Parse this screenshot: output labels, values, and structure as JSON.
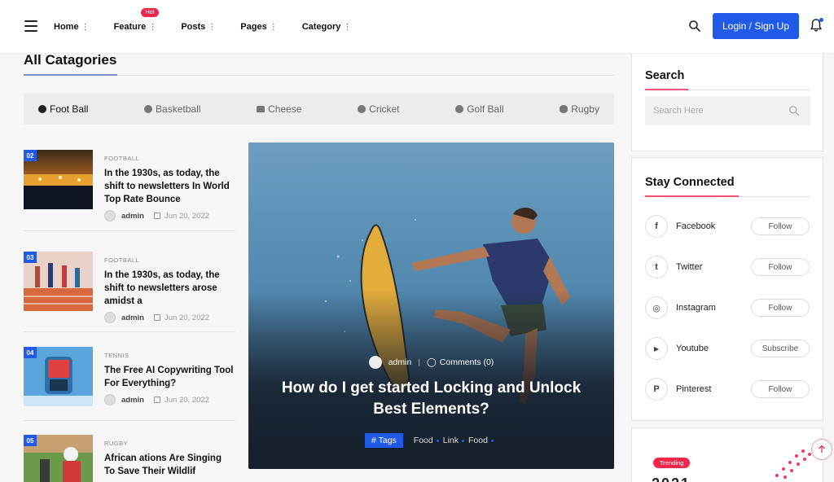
{
  "header": {
    "nav": [
      {
        "label": "Home",
        "dots": "⋮"
      },
      {
        "label": "Feature",
        "dots": "⋮",
        "badge": "Hot"
      },
      {
        "label": "Posts",
        "dots": "⋮"
      },
      {
        "label": "Pages",
        "dots": "⋮"
      },
      {
        "label": "Category",
        "dots": "⋮"
      }
    ],
    "login_label": "Login / Sign Up"
  },
  "categories": {
    "title": "All Catagories",
    "items": [
      "Foot Ball",
      "Basketball",
      "Cheese",
      "Cricket",
      "Golf Ball",
      "Rugby"
    ]
  },
  "posts": [
    {
      "num": "02",
      "category": "FOOTBALL",
      "title": "In the 1930s, as today, the shift to newsletters In World Top Rate Bounce",
      "author": "admin",
      "date": "Jun 20, 2022"
    },
    {
      "num": "03",
      "category": "FOOTBALL",
      "title": "In the 1930s, as today, the shift to newsletters arose amidst a",
      "author": "admin",
      "date": "Jun 20, 2022"
    },
    {
      "num": "04",
      "category": "TENNIS",
      "title": "The Free AI Copywriting Tool For Everything?",
      "author": "admin",
      "date": "Jun 20, 2022"
    },
    {
      "num": "05",
      "category": "RUGBY",
      "title": "African ations Are Singing To Save Their Wildlif"
    }
  ],
  "featured": {
    "author": "admin",
    "comments": "Comments (0)",
    "title": "How do I get started Locking and Unlock Best Elements?",
    "tag_button": "# Tags",
    "tags": [
      "Food",
      "Link",
      "Food"
    ]
  },
  "sidebar": {
    "search_title": "Search",
    "search_placeholder": "Search Here",
    "connect_title": "Stay Connected",
    "social": [
      {
        "icon": "f",
        "name": "Facebook",
        "action": "Follow"
      },
      {
        "icon": "t",
        "name": "Twitter",
        "action": "Follow"
      },
      {
        "icon": "◎",
        "name": "Instagram",
        "action": "Follow"
      },
      {
        "icon": "▶",
        "name": "Youtube",
        "action": "Subscribe"
      },
      {
        "icon": "P",
        "name": "Pinterest",
        "action": "Follow"
      }
    ],
    "trending_badge": "Trending",
    "trending_partial": "2021 ..."
  },
  "colors": {
    "accent": "#1f5ae8",
    "hot": "#f0274b",
    "widget_underline": "#ef5577"
  }
}
